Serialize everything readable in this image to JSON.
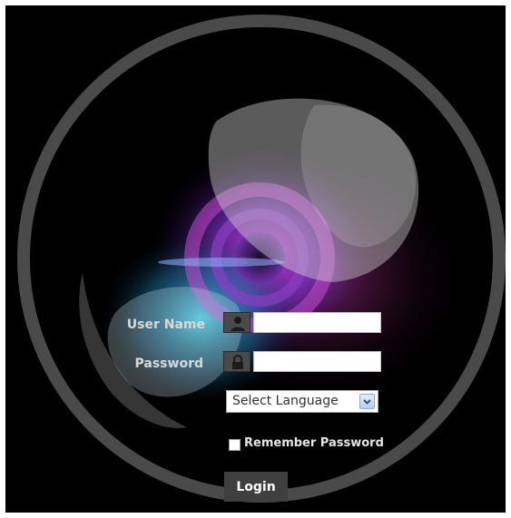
{
  "login_form": {
    "username_label": "User Name",
    "username_value": "",
    "password_label": "Password",
    "password_value": "",
    "language_select": "Select Language",
    "remember_label": "Remember Password",
    "remember_checked": false,
    "login_button": "Login"
  },
  "icons": {
    "username": "user-icon",
    "password": "lock-icon",
    "language_dropdown": "chevron-down-icon"
  },
  "colors": {
    "background": "#000000",
    "ring": "#4a4a4a",
    "button": "#3f3f3f",
    "label_text": "#d9d9d9"
  }
}
